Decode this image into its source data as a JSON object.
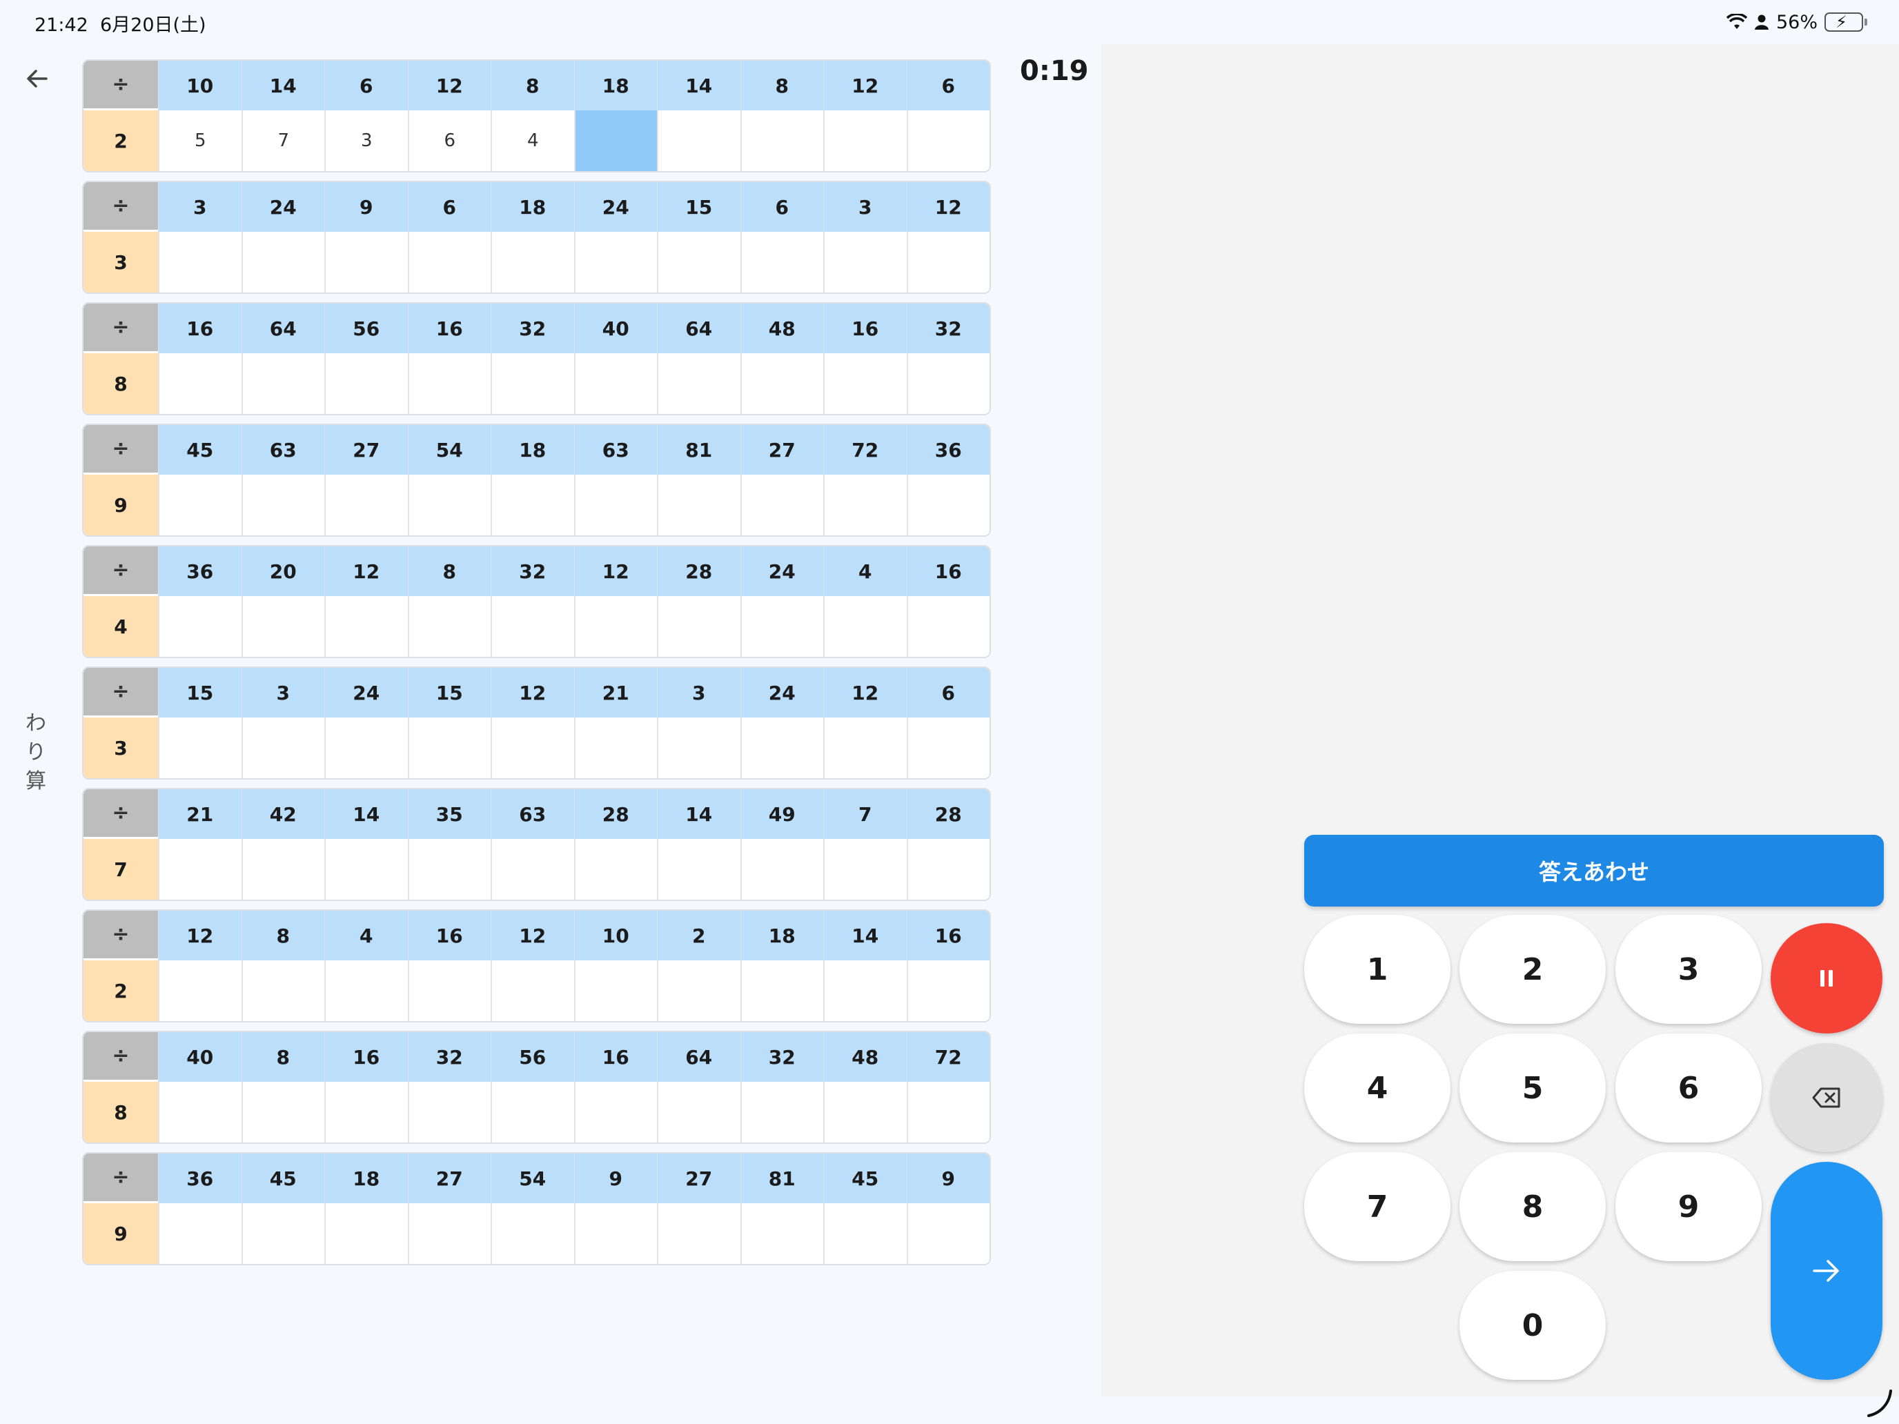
{
  "status": {
    "time": "21:42",
    "date": "6月20日(土)",
    "battery": "56%"
  },
  "side_label": "わり算",
  "timer": "0:19",
  "operator": "÷",
  "rows": [
    {
      "divisor": "2",
      "dividends": [
        "10",
        "14",
        "6",
        "12",
        "8",
        "18",
        "14",
        "8",
        "12",
        "6"
      ],
      "answers": [
        "5",
        "7",
        "3",
        "6",
        "4",
        "",
        "",
        "",
        "",
        ""
      ]
    },
    {
      "divisor": "3",
      "dividends": [
        "3",
        "24",
        "9",
        "6",
        "18",
        "24",
        "15",
        "6",
        "3",
        "12"
      ],
      "answers": [
        "",
        "",
        "",
        "",
        "",
        "",
        "",
        "",
        "",
        ""
      ]
    },
    {
      "divisor": "8",
      "dividends": [
        "16",
        "64",
        "56",
        "16",
        "32",
        "40",
        "64",
        "48",
        "16",
        "32"
      ],
      "answers": [
        "",
        "",
        "",
        "",
        "",
        "",
        "",
        "",
        "",
        ""
      ]
    },
    {
      "divisor": "9",
      "dividends": [
        "45",
        "63",
        "27",
        "54",
        "18",
        "63",
        "81",
        "27",
        "72",
        "36"
      ],
      "answers": [
        "",
        "",
        "",
        "",
        "",
        "",
        "",
        "",
        "",
        ""
      ]
    },
    {
      "divisor": "4",
      "dividends": [
        "36",
        "20",
        "12",
        "8",
        "32",
        "12",
        "28",
        "24",
        "4",
        "16"
      ],
      "answers": [
        "",
        "",
        "",
        "",
        "",
        "",
        "",
        "",
        "",
        ""
      ]
    },
    {
      "divisor": "3",
      "dividends": [
        "15",
        "3",
        "24",
        "15",
        "12",
        "21",
        "3",
        "24",
        "12",
        "6"
      ],
      "answers": [
        "",
        "",
        "",
        "",
        "",
        "",
        "",
        "",
        "",
        ""
      ]
    },
    {
      "divisor": "7",
      "dividends": [
        "21",
        "42",
        "14",
        "35",
        "63",
        "28",
        "14",
        "49",
        "7",
        "28"
      ],
      "answers": [
        "",
        "",
        "",
        "",
        "",
        "",
        "",
        "",
        "",
        ""
      ]
    },
    {
      "divisor": "2",
      "dividends": [
        "12",
        "8",
        "4",
        "16",
        "12",
        "10",
        "2",
        "18",
        "14",
        "16"
      ],
      "answers": [
        "",
        "",
        "",
        "",
        "",
        "",
        "",
        "",
        "",
        ""
      ]
    },
    {
      "divisor": "8",
      "dividends": [
        "40",
        "8",
        "16",
        "32",
        "56",
        "16",
        "64",
        "32",
        "48",
        "72"
      ],
      "answers": [
        "",
        "",
        "",
        "",
        "",
        "",
        "",
        "",
        "",
        ""
      ]
    },
    {
      "divisor": "9",
      "dividends": [
        "36",
        "45",
        "18",
        "27",
        "54",
        "9",
        "27",
        "81",
        "45",
        "9"
      ],
      "answers": [
        "",
        "",
        "",
        "",
        "",
        "",
        "",
        "",
        "",
        ""
      ]
    }
  ],
  "active_cell": {
    "row": 0,
    "col": 5
  },
  "keypad": {
    "check_label": "答えあわせ",
    "keys": [
      "1",
      "2",
      "3",
      "4",
      "5",
      "6",
      "7",
      "8",
      "9",
      "0"
    ]
  },
  "colors": {
    "header_blue": "#bbdefb",
    "divisor_orange": "#ffe0b2",
    "active_cell": "#90caf9",
    "check_button": "#1e88e5",
    "pause_button": "#f44336",
    "next_button": "#2196f3"
  },
  "icons": {
    "back": "arrow-left-icon",
    "pause": "pause-icon",
    "backspace": "backspace-icon",
    "next": "arrow-right-icon",
    "wifi": "wifi-icon",
    "user": "person-icon",
    "battery": "battery-charging-icon"
  }
}
